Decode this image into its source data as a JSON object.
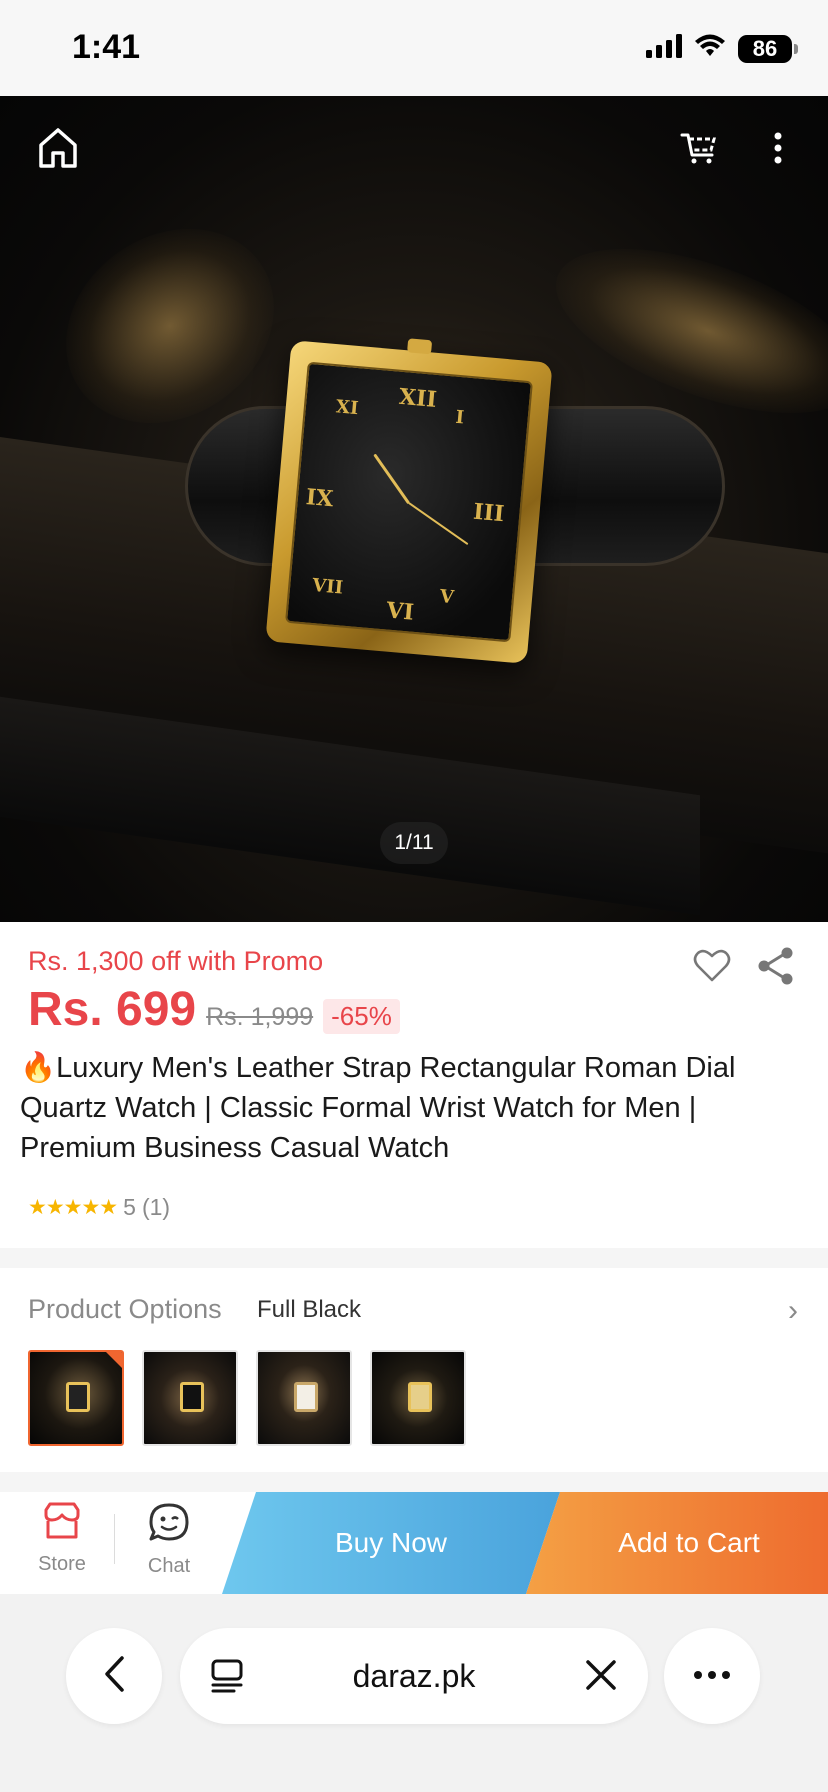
{
  "status_bar": {
    "time": "1:41",
    "battery": "86"
  },
  "gallery": {
    "page_indicator": "1/11"
  },
  "product": {
    "promo": "Rs. 1,300 off with Promo",
    "price": "Rs. 699",
    "original_price": "Rs. 1,999",
    "discount": "-65%",
    "title": "🔥Luxury Men's Leather Strap Rectangular Roman Dial Quartz Watch | Classic Formal Wrist Watch for Men | Premium Business Casual Watch",
    "rating_stars": "★★★★★",
    "rating_value": "5",
    "rating_count": "(1)"
  },
  "options": {
    "label": "Product Options",
    "selected": "Full Black",
    "chevron": "›"
  },
  "action_bar": {
    "store_label": "Store",
    "chat_label": "Chat",
    "buy_now": "Buy Now",
    "add_to_cart": "Add to Cart"
  },
  "browser": {
    "url": "daraz.pk"
  },
  "colors": {
    "accent_red": "#e8454a",
    "buy_blue": "#4aa3dc",
    "cart_orange": "#ee6c2f"
  }
}
